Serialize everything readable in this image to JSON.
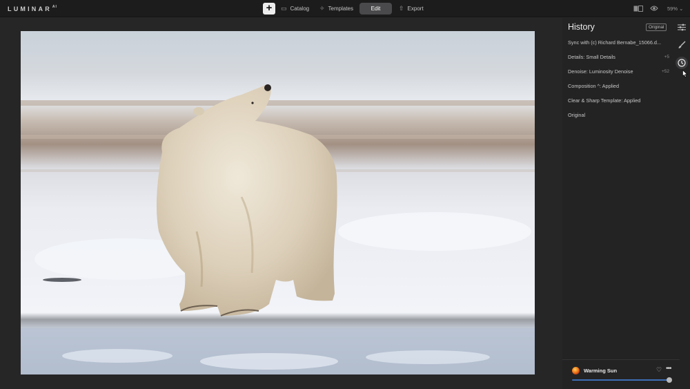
{
  "app": {
    "logo": "LUMINAR",
    "logo_suffix": "AI"
  },
  "topbar": {
    "add_label": "+",
    "nav": [
      {
        "label": "Catalog",
        "icon": "folder-icon"
      },
      {
        "label": "Templates",
        "icon": "templates-icon"
      },
      {
        "label": "Edit",
        "icon": "",
        "active": true
      },
      {
        "label": "Export",
        "icon": "export-icon"
      }
    ],
    "zoom": "59%"
  },
  "panel": {
    "title": "History",
    "badge": "Original",
    "history": [
      {
        "label": "Sync with (c) Richard Bernabe_15066.d...",
        "delta": ""
      },
      {
        "label": "Details: Small Details",
        "delta": "+5"
      },
      {
        "label": "Denoise: Luminosity Denoise",
        "delta": "+52"
      },
      {
        "label": "Composition ^: Applied",
        "delta": ""
      },
      {
        "label": "Clear & Sharp Template: Applied",
        "delta": ""
      },
      {
        "label": "Original",
        "delta": ""
      }
    ],
    "tools": [
      "adjustments-icon",
      "brush-icon",
      "history-clock-icon"
    ]
  },
  "preset": {
    "name": "Warming Sun",
    "amount": 1.0,
    "heart_icon": "heart-icon",
    "more_icon": "more-icon"
  },
  "colors": {
    "accent": "#3d6fb8",
    "panel": "#232324",
    "topbar": "#1c1c1d"
  }
}
